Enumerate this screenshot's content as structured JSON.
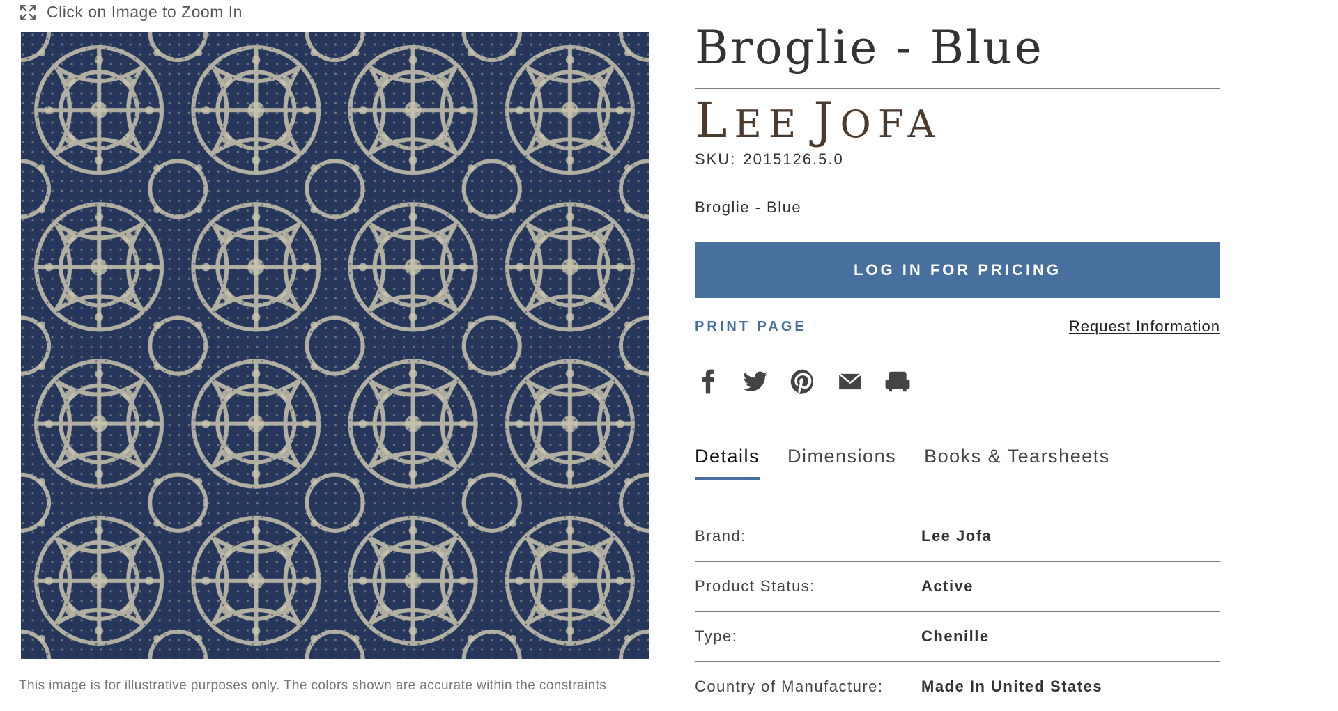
{
  "zoom_hint": {
    "label": "Click on Image to Zoom In",
    "icon": "expand-icon"
  },
  "image": {
    "alt_colors": {
      "ground": "#27375c",
      "pattern": "#c9c4ae"
    }
  },
  "disclaimer": "This image is for illustrative purposes only. The colors shown are accurate within the constraints",
  "product": {
    "title": "Broglie - Blue",
    "brand_initial_1": "L",
    "brand_rest_1": "EE",
    "brand_initial_2": "J",
    "brand_rest_2": "OFA",
    "sku_label": "SKU:",
    "sku_value": "2015126.5.0",
    "subtitle": "Broglie - Blue"
  },
  "actions": {
    "pricing_label": "LOG IN FOR PRICING",
    "print_label": "PRINT PAGE",
    "request_label": "Request Information"
  },
  "social": [
    "facebook-icon",
    "twitter-icon",
    "pinterest-icon",
    "email-icon",
    "sample-chair-icon"
  ],
  "tabs": [
    {
      "label": "Details",
      "active": true
    },
    {
      "label": "Dimensions",
      "active": false
    },
    {
      "label": "Books & Tearsheets",
      "active": false
    }
  ],
  "details": [
    {
      "key": "Brand:",
      "value": "Lee Jofa"
    },
    {
      "key": "Product Status:",
      "value": "Active"
    },
    {
      "key": "Type:",
      "value": "Chenille"
    },
    {
      "key": "Country of Manufacture:",
      "value": "Made In United States"
    }
  ],
  "colors": {
    "accent": "#47709f",
    "brand": "#4b3a2e"
  }
}
